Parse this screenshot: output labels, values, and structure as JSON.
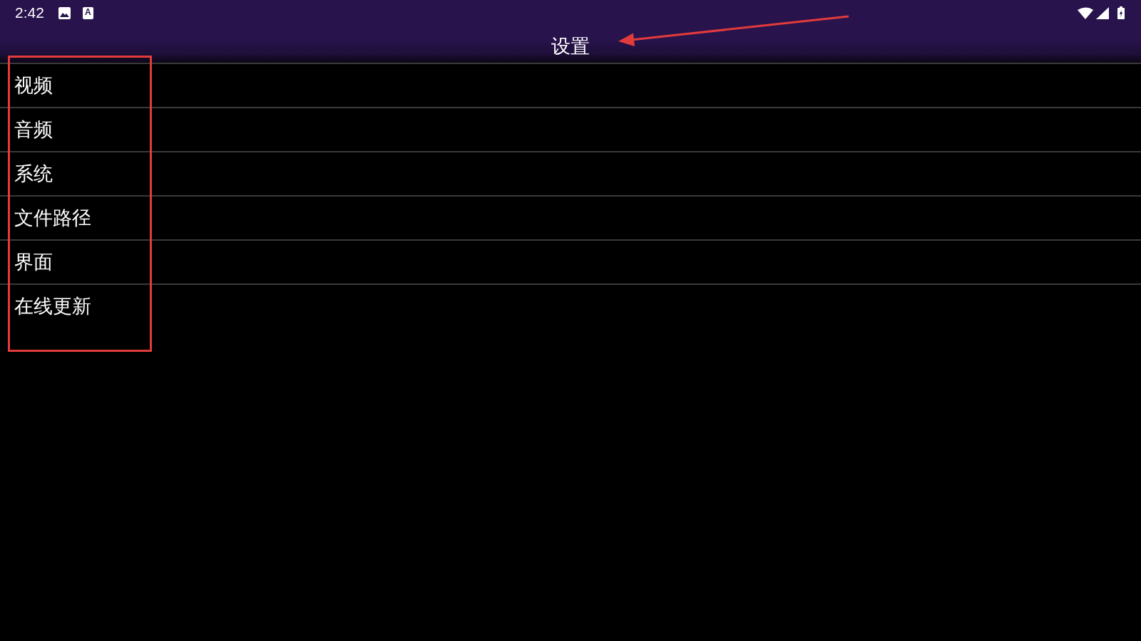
{
  "status_bar": {
    "time": "2:42",
    "input_indicator": "A"
  },
  "header": {
    "title": "设置"
  },
  "settings_list": [
    {
      "label": "视频"
    },
    {
      "label": "音频"
    },
    {
      "label": "系统"
    },
    {
      "label": "文件路径"
    },
    {
      "label": "界面"
    },
    {
      "label": "在线更新"
    }
  ]
}
